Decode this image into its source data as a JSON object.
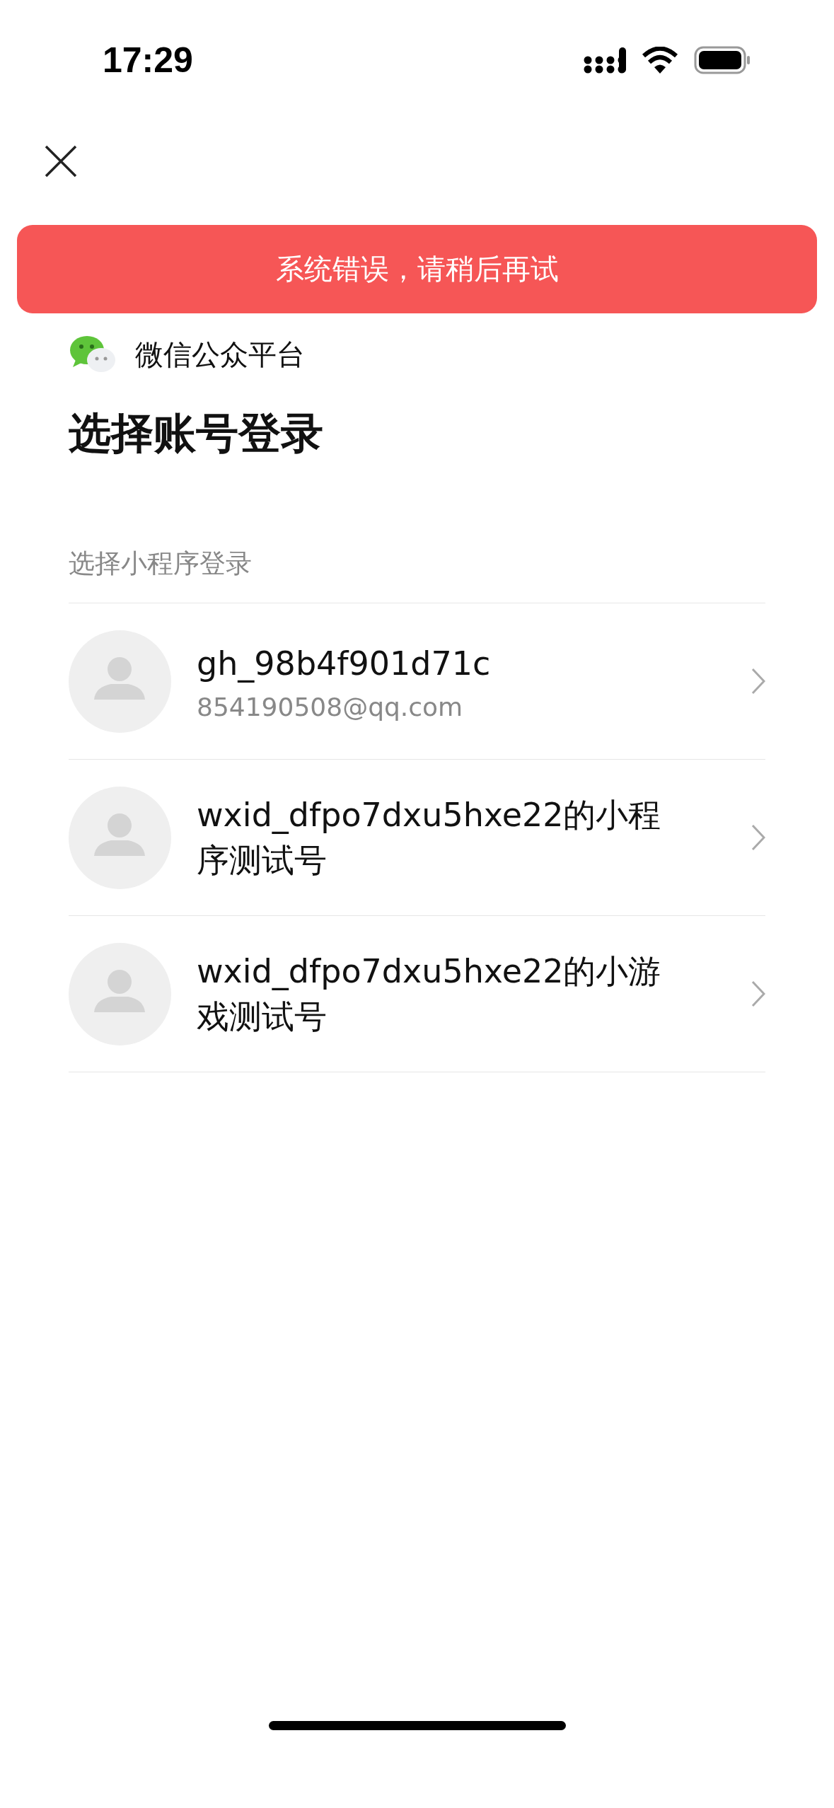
{
  "status_bar": {
    "time": "17:29"
  },
  "toast": {
    "message": "系统错误，请稍后再试"
  },
  "platform": {
    "name": "微信公众平台"
  },
  "title": "选择账号登录",
  "section": {
    "label": "选择小程序登录"
  },
  "accounts": [
    {
      "name": "gh_98b4f901d71c",
      "email": "854190508@qq.com"
    },
    {
      "name": "wxid_dfpo7dxu5hxe22的小程序测试号"
    },
    {
      "name": "wxid_dfpo7dxu5hxe22的小游戏测试号"
    }
  ]
}
